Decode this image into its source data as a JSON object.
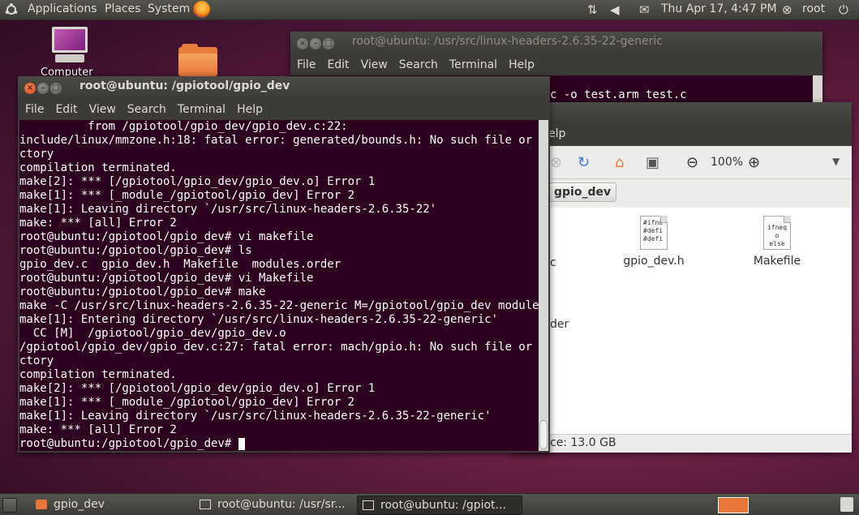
{
  "top_panel": {
    "menus": [
      "Applications",
      "Places",
      "System"
    ],
    "clock": "Thu Apr 17,  4:47 PM",
    "user": "root"
  },
  "desktop": {
    "computer_label": "Computer"
  },
  "back_terminal": {
    "title": "root@ubuntu: /usr/src/linux-headers-2.6.35-22-generic",
    "menu": [
      "File",
      "Edit",
      "View",
      "Search",
      "Terminal",
      "Help"
    ],
    "visible_line": "c -o test.arm test.c"
  },
  "file_manager": {
    "menu_partial": "elp",
    "zoom": "100%",
    "path_button": "gpio_dev",
    "files": [
      {
        "name": "gpio_dev.h",
        "preview": [
          "#ifnd",
          "#defi",
          "",
          "#defi"
        ]
      },
      {
        "name": "Makefile",
        "preview": [
          "ifneq",
          "    o",
          "else"
        ]
      }
    ],
    "partial_file_label": "c",
    "partial_folder_label": "der",
    "status": "ce: 13.0 GB"
  },
  "front_terminal": {
    "title": "root@ubuntu: /gpiotool/gpio_dev",
    "menu": [
      "File",
      "Edit",
      "View",
      "Search",
      "Terminal",
      "Help"
    ],
    "lines": [
      "          from /gpiotool/gpio_dev/gpio_dev.c:22:",
      "include/linux/mmzone.h:18: fatal error: generated/bounds.h: No such file or dire",
      "ctory",
      "compilation terminated.",
      "make[2]: *** [/gpiotool/gpio_dev/gpio_dev.o] Error 1",
      "make[1]: *** [_module_/gpiotool/gpio_dev] Error 2",
      "make[1]: Leaving directory `/usr/src/linux-headers-2.6.35-22'",
      "make: *** [all] Error 2",
      "root@ubuntu:/gpiotool/gpio_dev# vi makefile",
      "root@ubuntu:/gpiotool/gpio_dev# ls",
      "gpio_dev.c  gpio_dev.h  Makefile  modules.order",
      "root@ubuntu:/gpiotool/gpio_dev# vi Makefile",
      "root@ubuntu:/gpiotool/gpio_dev# make",
      "make -C /usr/src/linux-headers-2.6.35-22-generic M=/gpiotool/gpio_dev modules",
      "make[1]: Entering directory `/usr/src/linux-headers-2.6.35-22-generic'",
      "  CC [M]  /gpiotool/gpio_dev/gpio_dev.o",
      "/gpiotool/gpio_dev/gpio_dev.c:27: fatal error: mach/gpio.h: No such file or dire",
      "ctory",
      "compilation terminated.",
      "make[2]: *** [/gpiotool/gpio_dev/gpio_dev.o] Error 1",
      "make[1]: *** [_module_/gpiotool/gpio_dev] Error 2",
      "make[1]: Leaving directory `/usr/src/linux-headers-2.6.35-22-generic'",
      "make: *** [all] Error 2"
    ],
    "prompt": "root@ubuntu:/gpiotool/gpio_dev# "
  },
  "taskbar": {
    "tasks": [
      "gpio_dev",
      "root@ubuntu: /usr/sr...",
      "root@ubuntu: /gpiot..."
    ]
  }
}
